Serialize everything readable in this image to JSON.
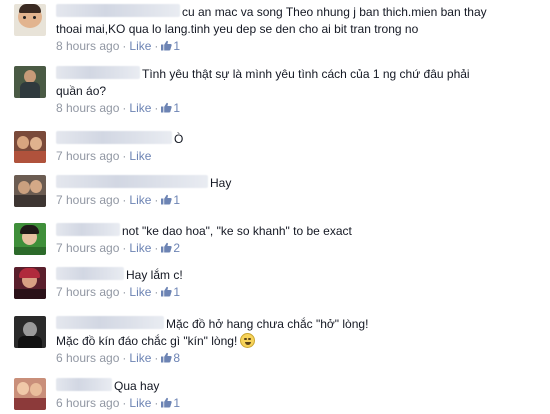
{
  "comments": [
    {
      "text_lines": [
        "cu an mac va song Theo nhung j ban thich.mien ban thay",
        "thoai mai,KO qua lo lang.tinh yeu dep se den cho ai bit tran trong no"
      ],
      "time": "8 hours ago",
      "like_label": "Like",
      "likes": "1"
    },
    {
      "text_lines": [
        "Tình yêu thật sự là mình yêu tình cách của 1 ng chứ đâu phải",
        "quần áo?"
      ],
      "time": "8 hours ago",
      "like_label": "Like",
      "likes": "1"
    },
    {
      "text_lines": [
        "Ò"
      ],
      "time": "7 hours ago",
      "like_label": "Like",
      "likes": ""
    },
    {
      "text_lines": [
        "Hay"
      ],
      "time": "7 hours ago",
      "like_label": "Like",
      "likes": "1"
    },
    {
      "text_lines": [
        "not \"ke dao hoa\", \"ke so khanh\" to be exact"
      ],
      "time": "7 hours ago",
      "like_label": "Like",
      "likes": "2"
    },
    {
      "text_lines": [
        "Hay lắm c!"
      ],
      "time": "7 hours ago",
      "like_label": "Like",
      "likes": "1"
    },
    {
      "text_lines": [
        "Mặc đồ hở hang chưa chắc \"hở\" lòng!",
        "Mặc đồ kín đáo chắc gì \"kín\" lòng!"
      ],
      "time": "6 hours ago",
      "like_label": "Like",
      "likes": "8"
    },
    {
      "text_lines": [
        "Qua hay"
      ],
      "time": "6 hours ago",
      "like_label": "Like",
      "likes": "1"
    }
  ],
  "colors": {
    "link": "#6d84b4",
    "meta": "#9197a3",
    "text": "#141823"
  },
  "icons": {
    "like_count": "thumbs-up-icon",
    "emoticon": "grin-emoticon-icon"
  }
}
